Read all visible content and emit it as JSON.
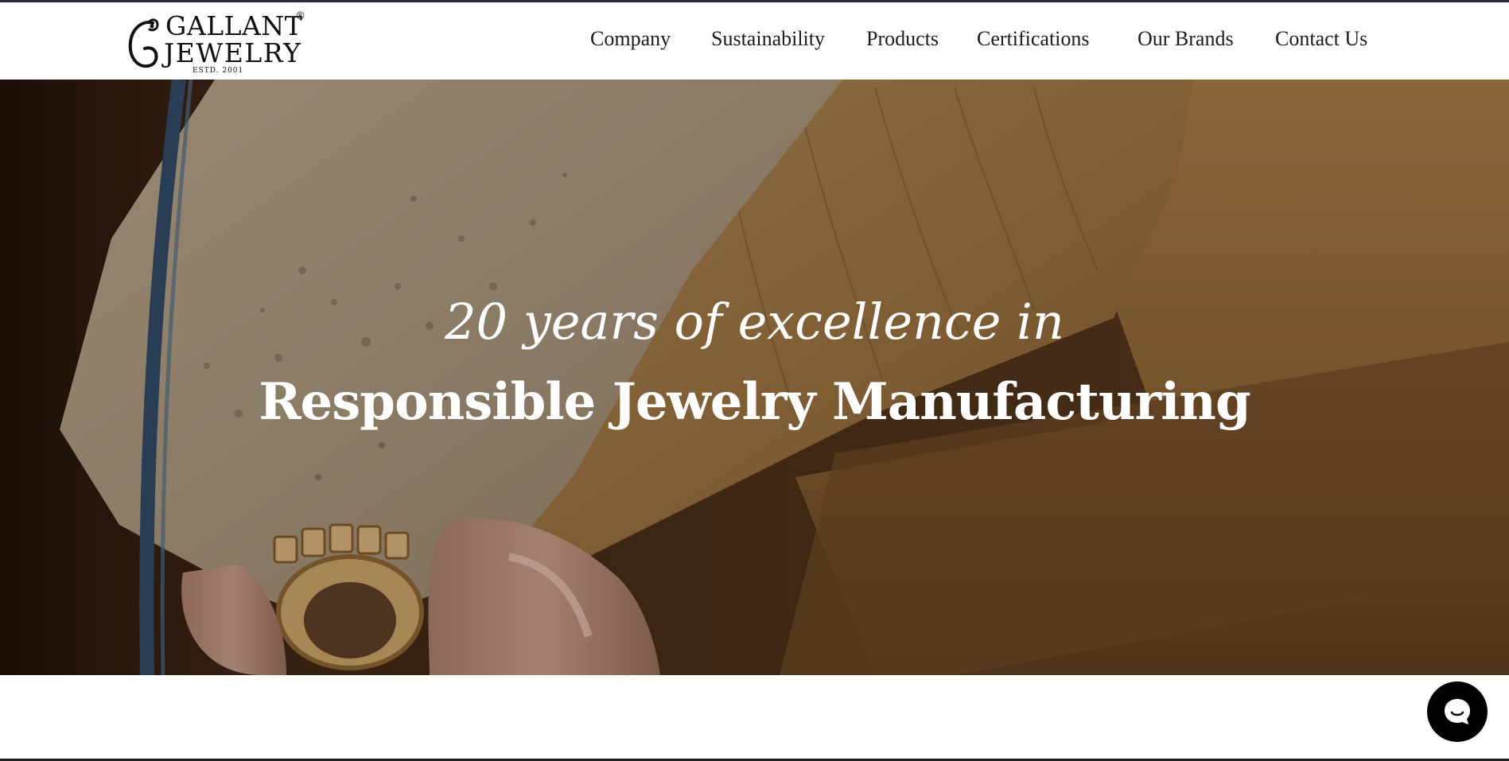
{
  "brand": {
    "name_line1": "GALLANT",
    "registered_mark": "®",
    "name_line2": "JEWELRY",
    "established": "ESTD. 2001"
  },
  "nav": {
    "items": [
      {
        "label": "Company"
      },
      {
        "label": "Sustainability"
      },
      {
        "label": "Products"
      },
      {
        "label": "Certifications"
      },
      {
        "label": "Our Brands"
      },
      {
        "label": "Contact Us"
      }
    ]
  },
  "hero": {
    "subtitle": "20 years of excellence in",
    "title": "Responsible Jewelry Manufacturing",
    "image_subject": "jeweler-filing-ring-at-bench-pin"
  },
  "chat": {
    "icon": "chat-bubble-icon"
  },
  "colors": {
    "header_background": "#ffffff",
    "nav_text": "#1c1c1c",
    "hero_text": "#ffffff",
    "chat_button": "#000000",
    "top_rule": "#2b2d44"
  }
}
